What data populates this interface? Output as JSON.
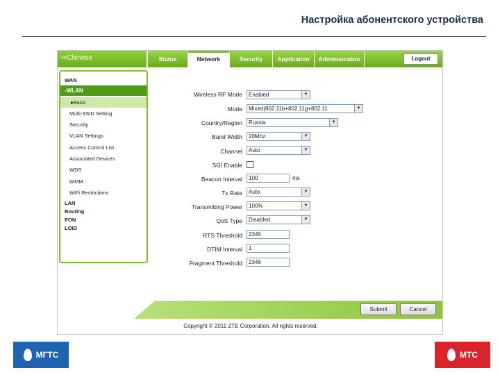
{
  "slide_title": "Настройка абонентского устройства",
  "brand_label": "⇨Chinese",
  "tabs": [
    "Status",
    "Network",
    "Security",
    "Application",
    "Administration"
  ],
  "active_tab": "Network",
  "logout_label": "Logout",
  "menu": {
    "wan": "WAN",
    "wlan": "-WLAN",
    "basic": "●Basic",
    "sub_items": [
      "Multi-SSID Setting",
      "Security",
      "VLAN Settings",
      "Access Control List",
      "Associated Devices",
      "WDS",
      "WMM",
      "WiFi Restrictions"
    ],
    "bottom_items": [
      "LAN",
      "Routing",
      "PON",
      "LOID"
    ]
  },
  "form": {
    "labels": [
      "Wireless RF Mode",
      "Mode",
      "Country/Region",
      "Band Width",
      "Channel",
      "SGI Enable",
      "Beacon Interval",
      "Tx Rate",
      "Transmitting Power",
      "QoS Type",
      "RTS Threshold",
      "DTIM Interval",
      "Fragment Threshold"
    ],
    "rf_mode": "Enabled",
    "mode": "Mixed(802.11b+802.11g+802.11",
    "country": "Russia",
    "band_width": "20Mhz",
    "channel": "Auto",
    "beacon_interval": "100",
    "beacon_unit": "ms",
    "tx_rate": "Auto",
    "tx_power": "100%",
    "qos_type": "Disabled",
    "rts_threshold": "2346",
    "dtim_interval": "1",
    "fragment_threshold": "2346"
  },
  "buttons": {
    "submit": "Submit",
    "cancel": "Cancel"
  },
  "copyright": "Copyright © 2011 ZTE Corporation. All rights reserved.",
  "logos": {
    "left": "МГТС",
    "right": "МТС"
  },
  "colors": {
    "accent_green": "#7cbe2c",
    "dark_green": "#4f9a17",
    "mgts_blue": "#1f63b3",
    "mts_red": "#d8242a",
    "title_navy": "#1a2b4f"
  }
}
